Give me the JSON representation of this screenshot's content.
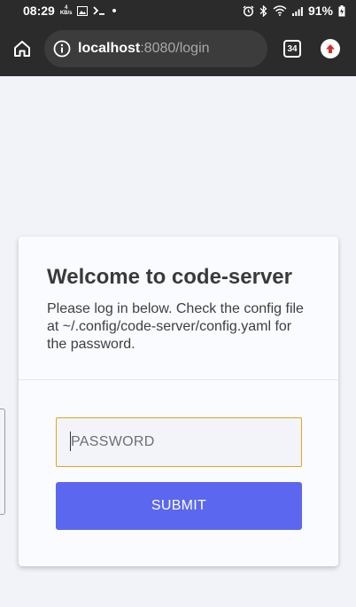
{
  "status_bar": {
    "time": "08:29",
    "speed_value": "4",
    "speed_unit": "KB/s",
    "battery": "91%"
  },
  "browser": {
    "url_host": "localhost",
    "url_path": ":8080/login",
    "tab_count": "34"
  },
  "login": {
    "title": "Welcome to code-server",
    "subtitle": "Please log in below. Check the config file at ~/.config/code-server/config.yaml for the password.",
    "password_placeholder": "PASSWORD",
    "submit_label": "SUBMIT"
  },
  "colors": {
    "accent": "#5a67ee",
    "input_focus_border": "#e0a420",
    "browser_chrome": "#2b2b2b"
  },
  "icons": {
    "home": "home-icon",
    "info": "info-icon",
    "tabs": "tabs-icon",
    "extension": "upload-icon"
  }
}
